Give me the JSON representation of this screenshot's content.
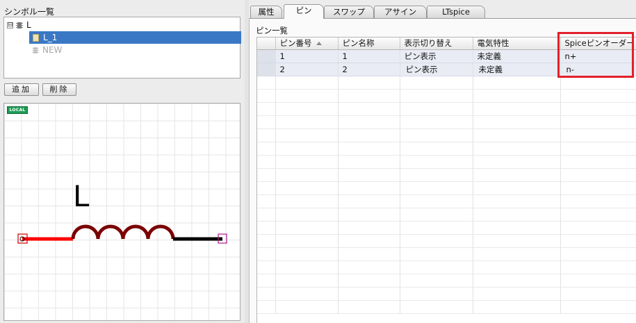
{
  "symbol_panel": {
    "title": "シンボル一覧",
    "tree": {
      "root_label": "L",
      "expander": "⊟",
      "items": [
        {
          "label": "L_1",
          "selected": true
        },
        {
          "label": "NEW",
          "selected": false
        }
      ]
    },
    "add_button": "追加",
    "delete_button": "削除"
  },
  "canvas": {
    "badge": "LOCAL",
    "symbol_label": "L",
    "colors": {
      "left_lead": "#ff0000",
      "coil": "#7a0000",
      "right_lead": "#000000",
      "pin_marker_left": "#cc0000",
      "pin_marker_right": "#b0178e"
    }
  },
  "tabs": [
    {
      "label": "属性",
      "active": false
    },
    {
      "label": "ピン",
      "active": true
    },
    {
      "label": "スワップ",
      "active": false
    },
    {
      "label": "アサイン",
      "active": false
    },
    {
      "label": "LTspice",
      "active": false
    }
  ],
  "pin_panel": {
    "title": "ピン一覧",
    "columns": [
      "ピン番号",
      "ピン名称",
      "表示切り替え",
      "電気特性",
      "Spiceピンオーダー"
    ],
    "sorted_column": 0,
    "rows": [
      {
        "number": "1",
        "name": "1",
        "display": "ピン表示",
        "electrical": "未定義",
        "spice_order": "n+"
      },
      {
        "number": "2",
        "name": "2",
        "display": "ピン表示",
        "electrical": "未定義",
        "spice_order": "n-"
      }
    ],
    "highlight_color": "#e3202b"
  }
}
